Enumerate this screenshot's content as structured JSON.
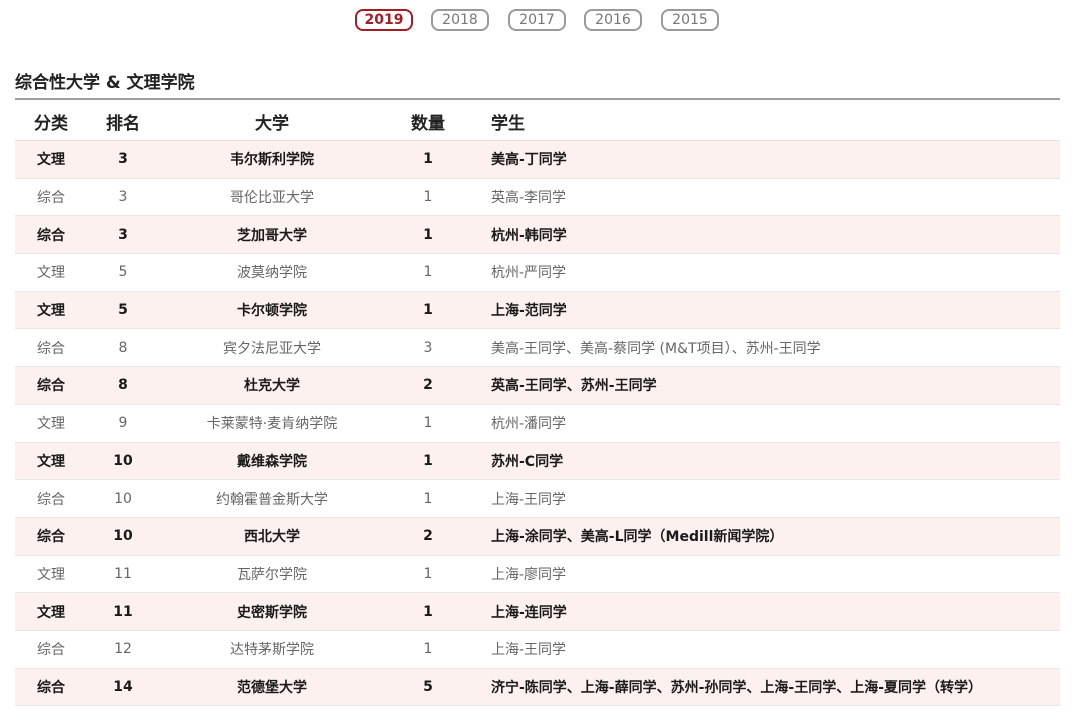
{
  "year_tabs": [
    {
      "label": "2019",
      "active": true
    },
    {
      "label": "2018",
      "active": false
    },
    {
      "label": "2017",
      "active": false
    },
    {
      "label": "2016",
      "active": false
    },
    {
      "label": "2015",
      "active": false
    }
  ],
  "section_title": "综合性大学 & 文理学院",
  "table": {
    "headers": {
      "category": "分类",
      "rank": "排名",
      "university": "大学",
      "count": "数量",
      "students": "学生"
    },
    "rows": [
      {
        "category": "文理",
        "rank": "3",
        "university": "韦尔斯利学院",
        "count": "1",
        "students": "美高-丁同学"
      },
      {
        "category": "综合",
        "rank": "3",
        "university": "哥伦比亚大学",
        "count": "1",
        "students": "英高-李同学"
      },
      {
        "category": "综合",
        "rank": "3",
        "university": "芝加哥大学",
        "count": "1",
        "students": "杭州-韩同学"
      },
      {
        "category": "文理",
        "rank": "5",
        "university": "波莫纳学院",
        "count": "1",
        "students": "杭州-严同学"
      },
      {
        "category": "文理",
        "rank": "5",
        "university": "卡尔顿学院",
        "count": "1",
        "students": "上海-范同学"
      },
      {
        "category": "综合",
        "rank": "8",
        "university": "宾夕法尼亚大学",
        "count": "3",
        "students": "美高-王同学、美高-蔡同学 (M&T项目）、苏州-王同学"
      },
      {
        "category": "综合",
        "rank": "8",
        "university": "杜克大学",
        "count": "2",
        "students": "英高-王同学、苏州-王同学"
      },
      {
        "category": "文理",
        "rank": "9",
        "university": "卡莱蒙特·麦肯纳学院",
        "count": "1",
        "students": "杭州-潘同学"
      },
      {
        "category": "文理",
        "rank": "10",
        "university": "戴维森学院",
        "count": "1",
        "students": "苏州-C同学"
      },
      {
        "category": "综合",
        "rank": "10",
        "university": "约翰霍普金斯大学",
        "count": "1",
        "students": "上海-王同学"
      },
      {
        "category": "综合",
        "rank": "10",
        "university": "西北大学",
        "count": "2",
        "students": "上海-涂同学、美高-L同学（Medill新闻学院）"
      },
      {
        "category": "文理",
        "rank": "11",
        "university": "瓦萨尔学院",
        "count": "1",
        "students": "上海-廖同学"
      },
      {
        "category": "文理",
        "rank": "11",
        "university": "史密斯学院",
        "count": "1",
        "students": "上海-连同学"
      },
      {
        "category": "综合",
        "rank": "12",
        "university": "达特茅斯学院",
        "count": "1",
        "students": "上海-王同学"
      },
      {
        "category": "综合",
        "rank": "14",
        "university": "范德堡大学",
        "count": "5",
        "students": "济宁-陈同学、上海-薛同学、苏州-孙同学、上海-王同学、上海-夏同学（转学）"
      }
    ]
  },
  "colors": {
    "accent": "#a51c24",
    "tab_border": "#9a9a9a",
    "odd_row_bg": "#fdf1f0",
    "rule": "#9e9e9e"
  }
}
